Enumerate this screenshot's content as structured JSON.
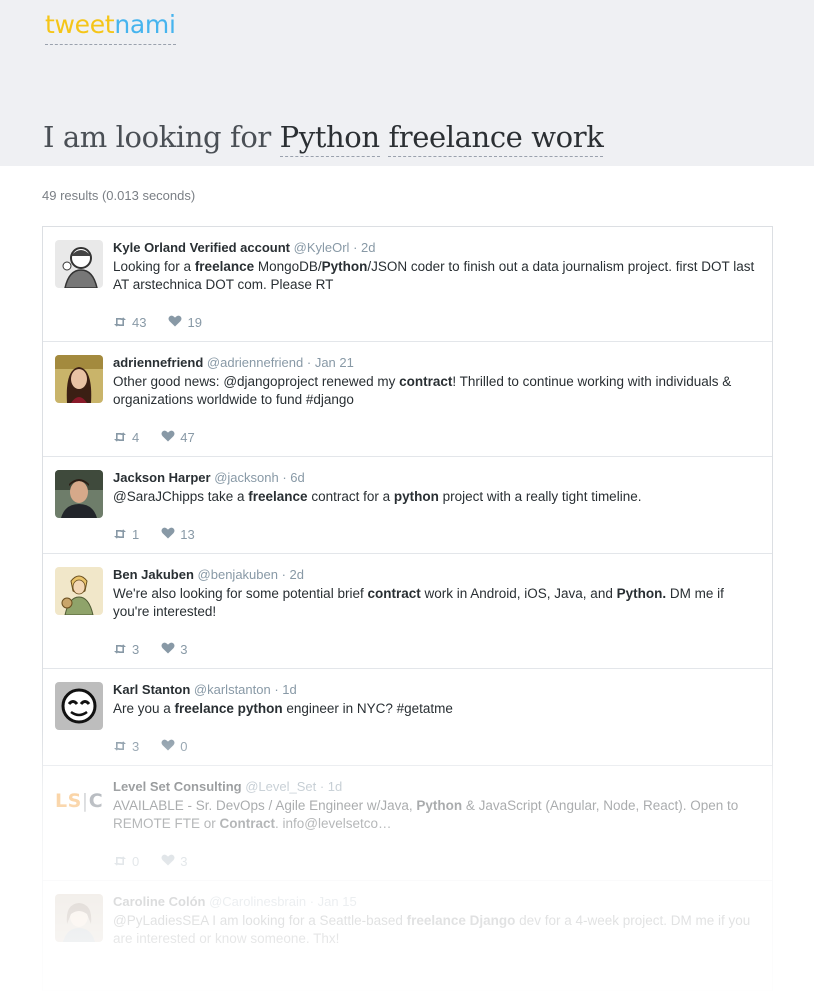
{
  "brand": {
    "part1": "tweet",
    "part2": "nami"
  },
  "query": {
    "prefix": "I am looking for",
    "term1": "Python",
    "term2": "freelance work"
  },
  "results_count": "49 results (0.013 seconds)",
  "colors": {
    "brand_yellow": "#f5c518",
    "brand_blue": "#46b4ee",
    "hero_bg": "#eff0f3",
    "muted": "#8899a6",
    "lsc_orange": "#f39c33"
  },
  "tweets": [
    {
      "name": "Kyle Orland Verified account",
      "handle": "@KyleOrl",
      "time": "· 2d",
      "segments": [
        [
          "Looking for a ",
          0
        ],
        [
          "freelance",
          1
        ],
        [
          " MongoDB/",
          0
        ],
        [
          "Python",
          1
        ],
        [
          "/JSON coder to finish out a data journalism project. first DOT last AT arstechnica DOT com. Please RT",
          0
        ]
      ],
      "retweets": "43",
      "likes": "19",
      "avatar": "avatar-kyle"
    },
    {
      "name": "adriennefriend",
      "handle": "@adriennefriend",
      "time": "· Jan 21",
      "segments": [
        [
          "Other good news: @djangoproject renewed my ",
          0
        ],
        [
          "contract",
          1
        ],
        [
          "! Thrilled to continue working with individuals & organizations worldwide to fund #django",
          0
        ]
      ],
      "retweets": "4",
      "likes": "47",
      "avatar": "avatar-adrienne"
    },
    {
      "name": "Jackson Harper",
      "handle": "@jacksonh",
      "time": "· 6d",
      "segments": [
        [
          "@SaraJChipps take a ",
          0
        ],
        [
          "freelance",
          1
        ],
        [
          " contract for a ",
          0
        ],
        [
          "python",
          1
        ],
        [
          " project with a really tight timeline.",
          0
        ]
      ],
      "retweets": "1",
      "likes": "13",
      "avatar": "avatar-jackson"
    },
    {
      "name": "Ben Jakuben",
      "handle": "@benjakuben",
      "time": "· 2d",
      "segments": [
        [
          "We're also looking for some potential brief ",
          0
        ],
        [
          "contract",
          1
        ],
        [
          " work in Android, iOS, Java, and ",
          0
        ],
        [
          "Python.",
          1
        ],
        [
          " DM me if you're interested!",
          0
        ]
      ],
      "retweets": "3",
      "likes": "3",
      "avatar": "avatar-ben"
    },
    {
      "name": "Karl Stanton",
      "handle": "@karlstanton",
      "time": "· 1d",
      "segments": [
        [
          "Are you a ",
          0
        ],
        [
          "freelance python",
          1
        ],
        [
          " engineer in NYC? #getatme",
          0
        ]
      ],
      "retweets": "3",
      "likes": "0",
      "avatar": "avatar-karl"
    },
    {
      "name": "Level Set Consulting",
      "handle": "@Level_Set",
      "time": "· 1d",
      "segments": [
        [
          "AVAILABLE - Sr. DevOps / Agile Engineer w/Java, ",
          0
        ],
        [
          "Python",
          1
        ],
        [
          " & JavaScript (Angular, Node, React). Open to REMOTE FTE or ",
          0
        ],
        [
          "Contract",
          1
        ],
        [
          ". info@levelsetco…",
          0
        ]
      ],
      "retweets": "0",
      "likes": "3",
      "avatar": "avatar-levelset",
      "avatar_text": "LS|C"
    },
    {
      "name": "Caroline Colón",
      "handle": "@Carolinesbrain",
      "time": "· Jan 15",
      "segments": [
        [
          "@PyLadiesSEA I am looking for a Seattle-based ",
          0
        ],
        [
          "freelance Django",
          1
        ],
        [
          " dev for a 4-week project. DM me if you are interested or know someone. Thx!",
          0
        ]
      ],
      "retweets": "",
      "likes": "",
      "avatar": "avatar-caroline"
    }
  ]
}
